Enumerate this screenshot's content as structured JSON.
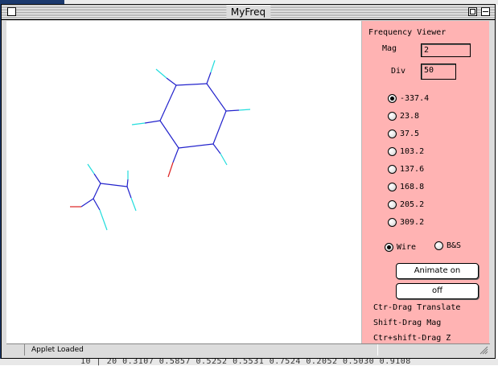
{
  "window": {
    "title": "MyFreq"
  },
  "background": {
    "bottom_text": "10 |    20  0.3107  0.5857  0.5252  0.5531  0.7524  0.2052  0.5030  0.9108"
  },
  "panel": {
    "title": "Frequency Viewer",
    "mag_label": "Mag",
    "mag_value": "2",
    "div_label": "Div",
    "div_value": "50",
    "frequencies": [
      "-337.4",
      "23.8",
      "37.5",
      "103.2",
      "137.6",
      "168.8",
      "205.2",
      "309.2"
    ],
    "selected_frequency": "-337.4",
    "render_modes": [
      "Wire",
      "B&S"
    ],
    "selected_mode": "Wire",
    "animate_button": "Animate on",
    "off_button": "off",
    "hints": [
      "Ctr-Drag Translate",
      "Shift-Drag Mag",
      "Ctr+shift-Drag Z"
    ]
  },
  "status": {
    "text": "Applet Loaded"
  },
  "colors": {
    "panel_bg": "#ffb3b3",
    "bond_blue": "#2222cc",
    "bond_cyan": "#22dddd",
    "bond_red": "#dd2222"
  }
}
